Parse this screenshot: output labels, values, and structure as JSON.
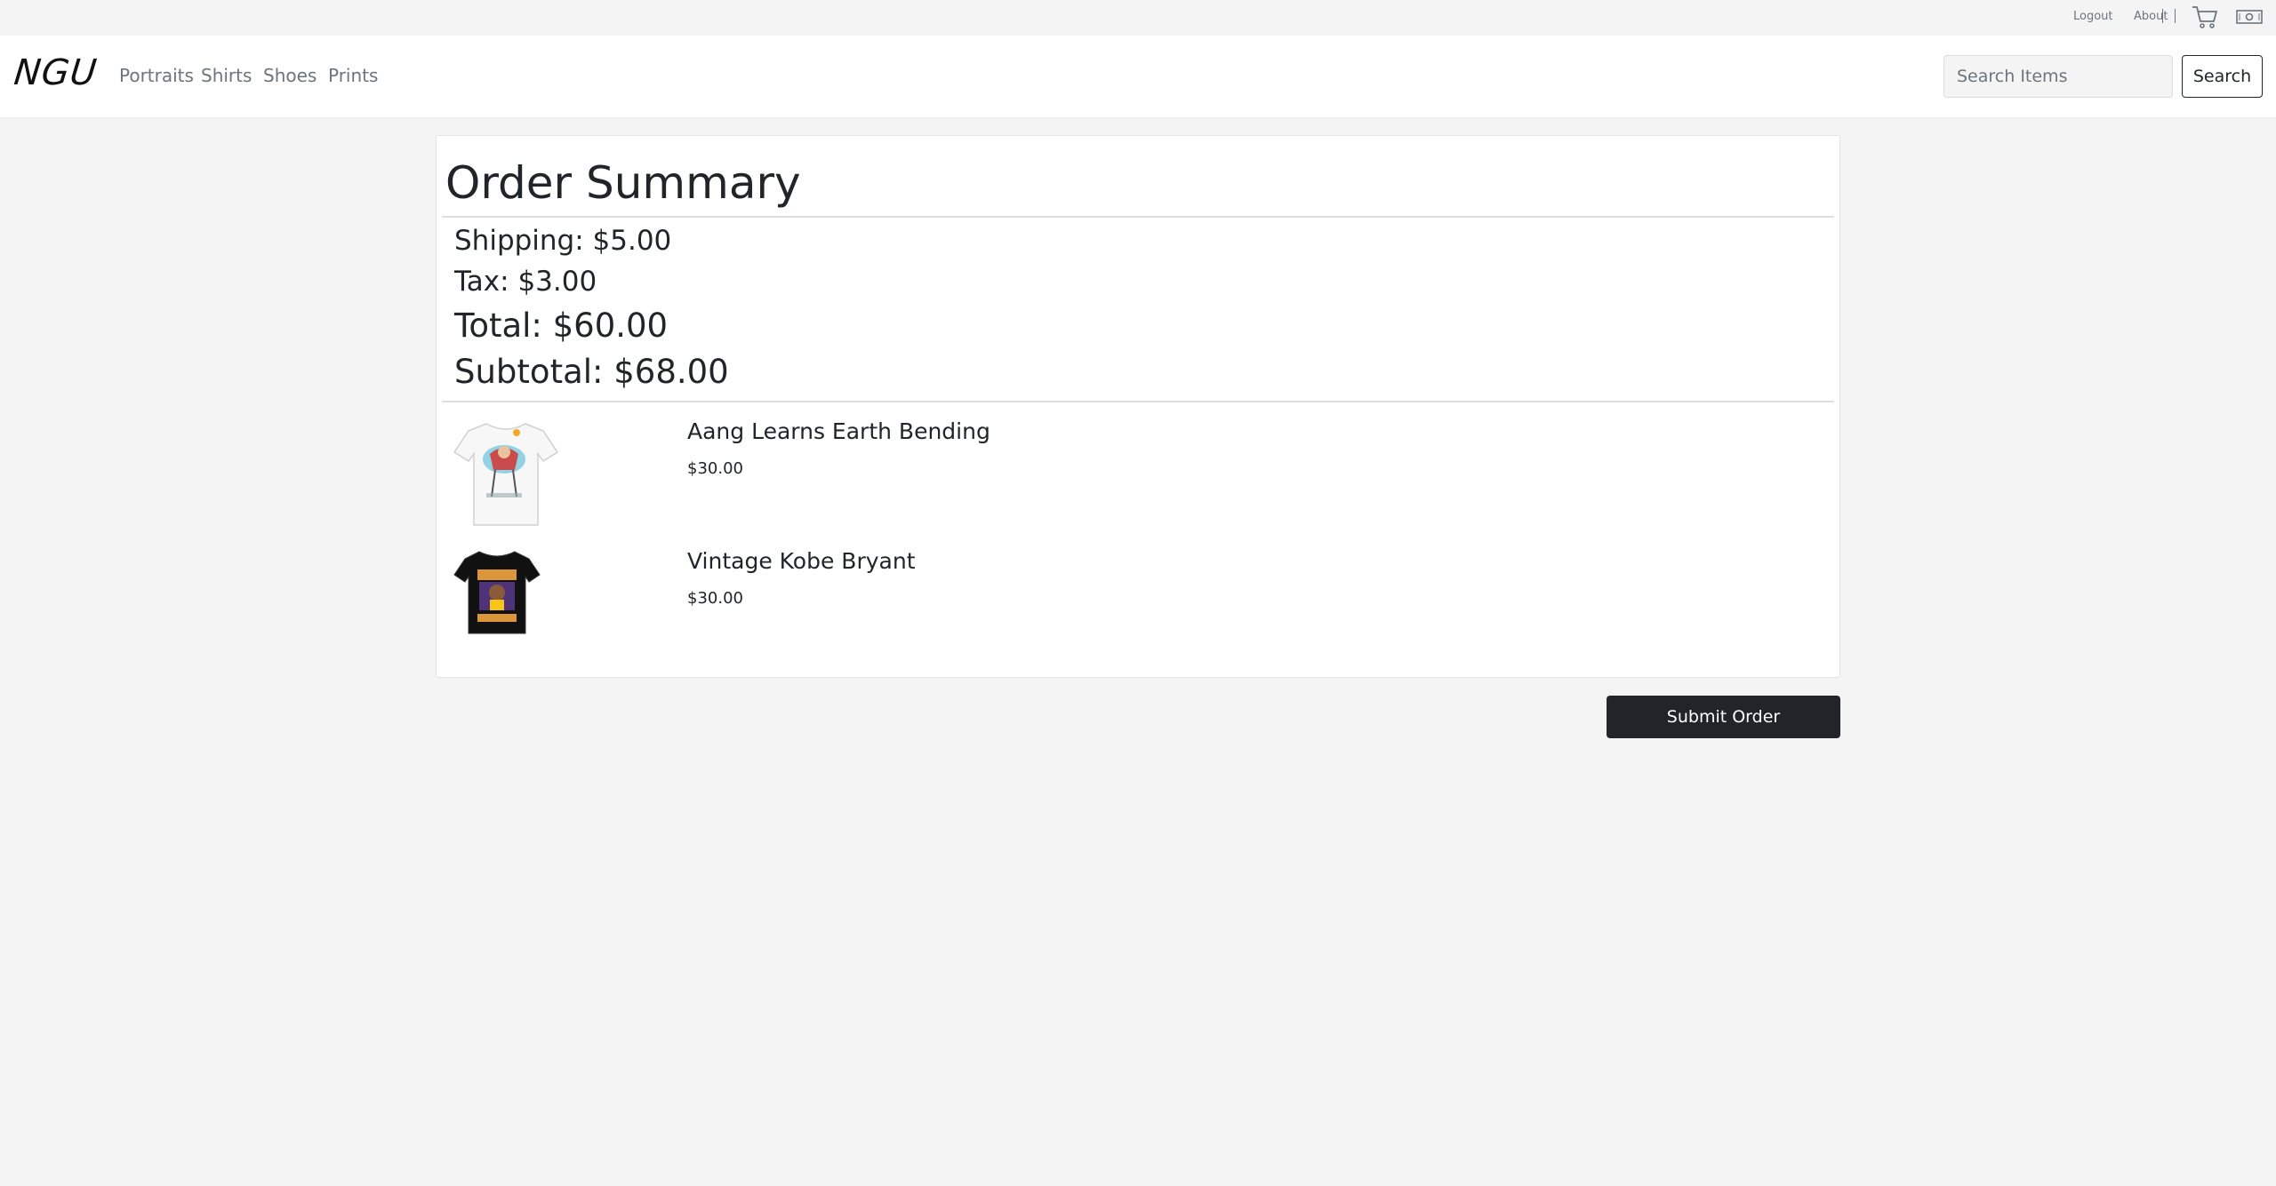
{
  "topbar": {
    "logout_label": "Logout",
    "about_label": "About",
    "cart_icon": "cart-icon",
    "money_icon": "money-icon"
  },
  "navbar": {
    "brand": "NGU",
    "links": [
      {
        "label": "Portraits"
      },
      {
        "label": "Shirts"
      },
      {
        "label": "Shoes"
      },
      {
        "label": "Prints"
      }
    ],
    "search_placeholder": "Search Items",
    "search_button": "Search"
  },
  "order": {
    "title": "Order Summary",
    "shipping": "Shipping: $5.00",
    "tax": "Tax: $3.00",
    "total": "Total: $60.00",
    "subtotal": "Subtotal: $68.00",
    "items": [
      {
        "name": "Aang Learns Earth Bending",
        "price": "$30.00",
        "shirt_color": "#f7f7f7"
      },
      {
        "name": "Vintage Kobe Bryant",
        "price": "$30.00",
        "shirt_color": "#111111"
      }
    ],
    "submit_label": "Submit Order"
  },
  "colors": {
    "page_bg": "#f4f4f4",
    "dark": "#212529",
    "muted": "#6c757d"
  }
}
